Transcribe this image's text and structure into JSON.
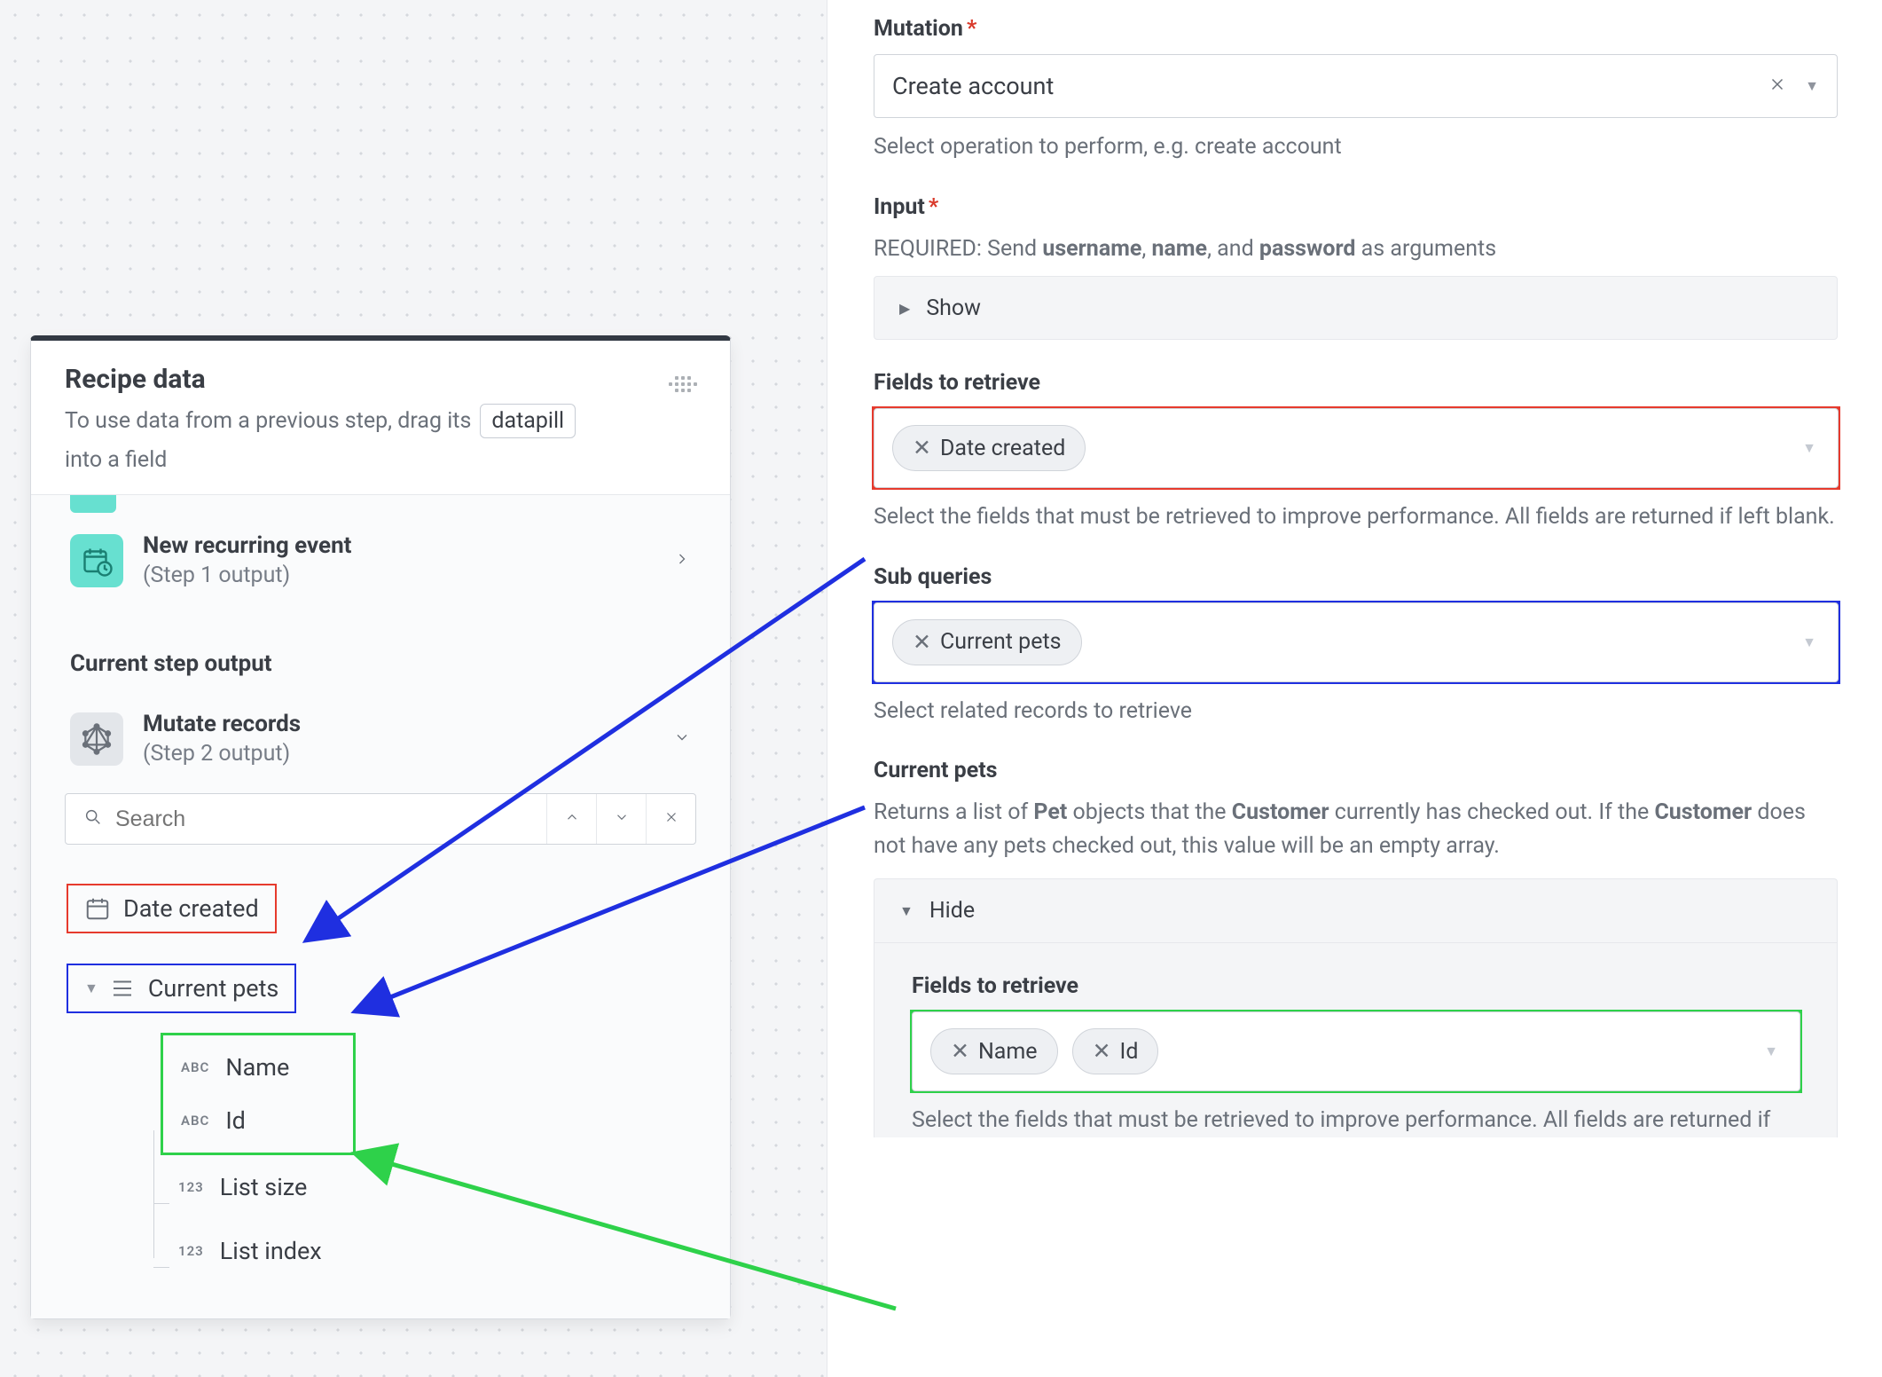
{
  "left_panel": {
    "title": "Recipe data",
    "subtitle_pre": "To use data from a previous step, drag its",
    "datapill_chip": "datapill",
    "subtitle_post": "into a field",
    "step1": {
      "title": "New recurring event",
      "sub": "(Step 1 output)"
    },
    "section_current": "Current step output",
    "step2": {
      "title": "Mutate records",
      "sub": "(Step 2 output)"
    },
    "search_placeholder": "Search",
    "pill_date": "Date created",
    "pill_pets": "Current pets",
    "leaf_name": "Name",
    "leaf_id": "Id",
    "leaf_size": "List size",
    "leaf_index": "List index"
  },
  "right_panel": {
    "mutation": {
      "label": "Mutation",
      "value": "Create account",
      "help": "Select operation to perform, e.g. create account"
    },
    "input": {
      "label": "Input",
      "help_pre": "REQUIRED: Send ",
      "u": "username",
      "n": "name",
      "p": "password",
      "help_post": " as arguments",
      "show": "Show"
    },
    "fields1": {
      "label": "Fields to retrieve",
      "chip": "Date created",
      "help": "Select the fields that must be retrieved to improve performance. All fields are returned if left blank."
    },
    "subq": {
      "label": "Sub queries",
      "chip": "Current pets",
      "help": "Select related records to retrieve"
    },
    "pets": {
      "label": "Current pets",
      "help_a": "Returns a list of ",
      "pet": "Pet",
      "help_b": " objects that the ",
      "cust": "Customer",
      "help_c": " currently has checked out. If the ",
      "help_d": " does not have any pets checked out, this value will be an empty array.",
      "hide": "Hide",
      "inner_label": "Fields to retrieve",
      "chip_name": "Name",
      "chip_id": "Id",
      "inner_help": "Select the fields that must be retrieved to improve performance. All fields are returned if"
    }
  }
}
